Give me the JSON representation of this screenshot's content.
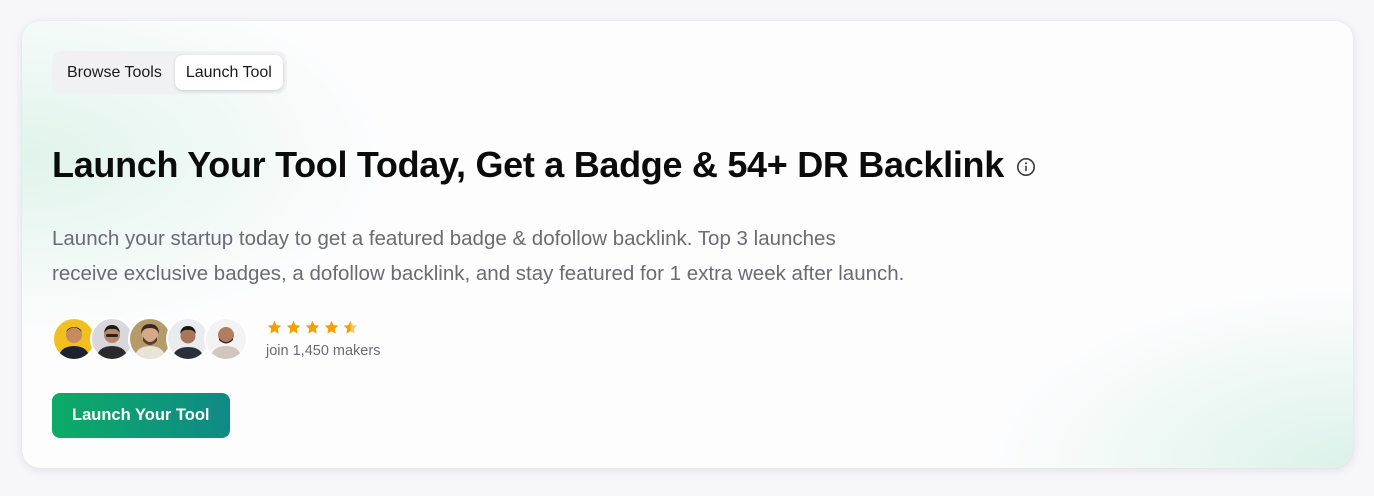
{
  "tabs": [
    {
      "label": "Browse Tools",
      "active": false
    },
    {
      "label": "Launch Tool",
      "active": true
    }
  ],
  "headline": "Launch Your Tool Today, Get a Badge & 54+ DR Backlink",
  "info_icon": "info-circle-icon",
  "description_line1": "Launch your startup today to get a featured badge & dofollow backlink. Top 3 launches",
  "description_line2": "receive exclusive badges, a dofollow backlink, and stay featured for 1 extra week after launch.",
  "social_proof": {
    "avatar_count": 5,
    "rating": 4.5,
    "rating_max": 5,
    "makers_text": "join 1,450 makers"
  },
  "cta_label": "Launch Your Tool",
  "colors": {
    "star": "#f5a000",
    "cta_start": "#0cab67",
    "cta_end": "#0f8a86",
    "text_muted": "#6b6b74"
  }
}
